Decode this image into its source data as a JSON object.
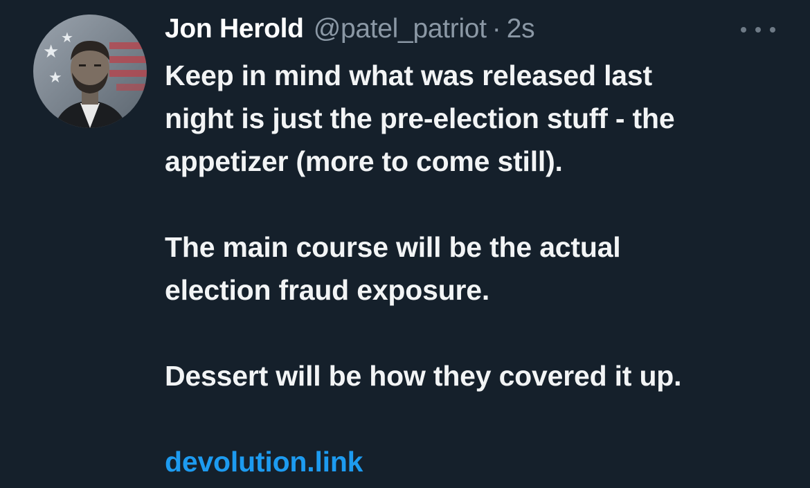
{
  "tweet": {
    "author": {
      "name": "Jon Herold",
      "handle": "@patel_patriot",
      "separator": "·",
      "time": "2s"
    },
    "body": {
      "lines_p1": [
        "Keep in mind what was released last",
        "night is just the pre-election stuff - the",
        "appetizer (more to come still)."
      ],
      "lines_p2": [
        "The main course will be the actual",
        "election fraud exposure."
      ],
      "lines_p3": [
        "Dessert will be how they covered it up."
      ],
      "link": "devolution.link"
    },
    "icons": {
      "more": "more-options-icon",
      "avatar": "profile-avatar"
    },
    "colors": {
      "background": "#15202b",
      "text": "#ffffff",
      "muted": "#8b98a5",
      "link": "#1d9bf0"
    }
  }
}
